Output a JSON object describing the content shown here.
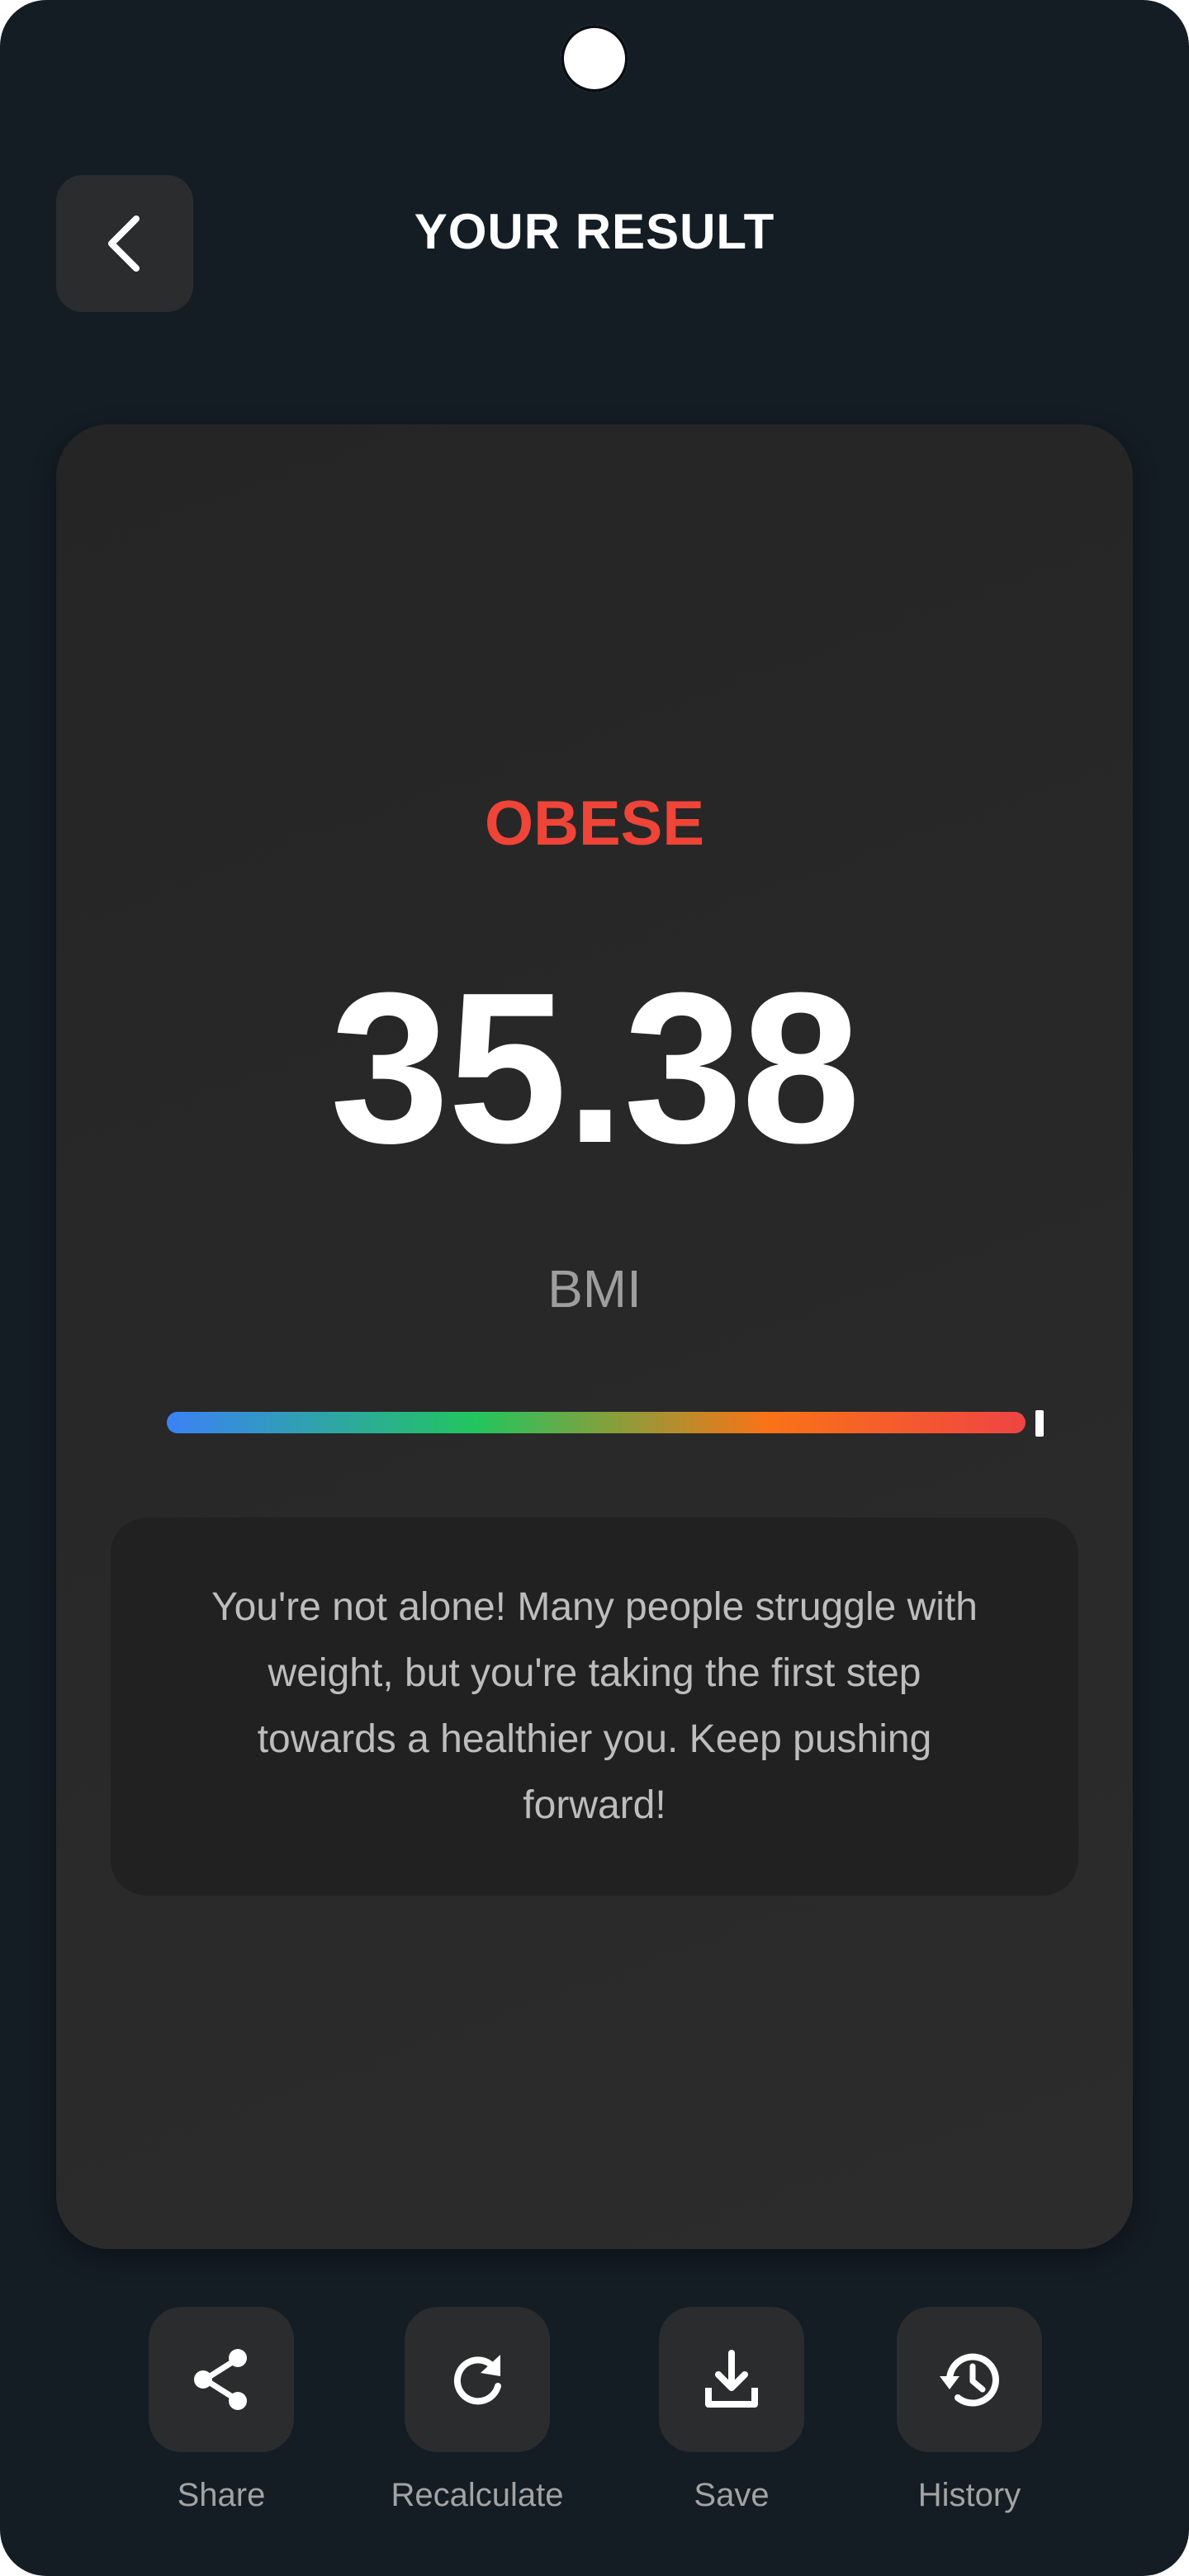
{
  "header": {
    "title": "YOUR RESULT",
    "back_icon": "chevron-left-icon"
  },
  "result": {
    "category": "OBESE",
    "category_color": "#ef4438",
    "bmi_value": "35.38",
    "bmi_label": "BMI",
    "gauge": {
      "marker_fraction": 1.0,
      "gradient_colors": [
        "#3b82f6",
        "#22c55e",
        "#f97316",
        "#ef4444"
      ]
    },
    "message": "You're not alone! Many people struggle with weight, but you're taking the first step towards a healthier you. Keep pushing forward!"
  },
  "actions": [
    {
      "label": "Share",
      "icon": "share-icon"
    },
    {
      "label": "Recalculate",
      "icon": "refresh-icon"
    },
    {
      "label": "Save",
      "icon": "download-icon"
    },
    {
      "label": "History",
      "icon": "history-icon"
    }
  ],
  "colors": {
    "background": "#141c24",
    "card": "#2a2a2a",
    "button": "#2b2c2e"
  }
}
